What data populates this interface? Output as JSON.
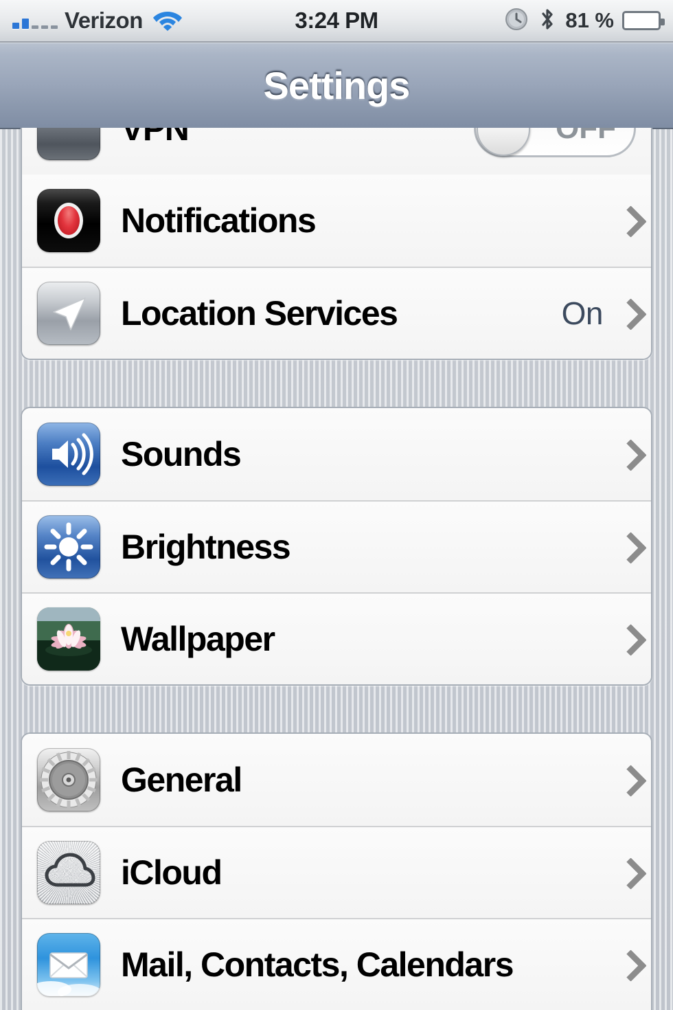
{
  "status_bar": {
    "carrier": "Verizon",
    "signal_bars_filled": 2,
    "signal_bars_total": 5,
    "wifi_icon": "wifi-icon",
    "time": "3:24 PM",
    "alarm_icon": "alarm-clock-icon",
    "bluetooth_icon": "bluetooth-icon",
    "battery_percent": "81 %",
    "battery_level": 81,
    "battery_color": "#5bc52c"
  },
  "nav_bar": {
    "title": "Settings"
  },
  "colors": {
    "accent_value": "#3c4a5e",
    "chevron": "#8c8c8c",
    "nav_bar": "#8c99ae",
    "group_bg": "#f7f7f7",
    "page_bg": "#c9ced6"
  },
  "groups": [
    {
      "id": "group-connectivity",
      "clipped_top": true,
      "rows": [
        {
          "id": "row-vpn",
          "label": "VPN",
          "icon": "vpn-icon",
          "control": "toggle",
          "toggle_label": "OFF",
          "toggle_on": false,
          "clipped": true
        },
        {
          "id": "row-notifications",
          "label": "Notifications",
          "icon": "notifications-icon",
          "value": "",
          "control": "disclosure"
        },
        {
          "id": "row-location-services",
          "label": "Location Services",
          "icon": "location-arrow-icon",
          "value": "On",
          "control": "disclosure"
        }
      ]
    },
    {
      "id": "group-display",
      "clipped_top": false,
      "rows": [
        {
          "id": "row-sounds",
          "label": "Sounds",
          "icon": "speaker-icon",
          "value": "",
          "control": "disclosure"
        },
        {
          "id": "row-brightness",
          "label": "Brightness",
          "icon": "sun-icon",
          "value": "",
          "control": "disclosure"
        },
        {
          "id": "row-wallpaper",
          "label": "Wallpaper",
          "icon": "water-lily-photo-icon",
          "value": "",
          "control": "disclosure"
        }
      ]
    },
    {
      "id": "group-system",
      "clipped_top": false,
      "clipped_bottom": true,
      "rows": [
        {
          "id": "row-general",
          "label": "General",
          "icon": "gears-icon",
          "value": "",
          "control": "disclosure"
        },
        {
          "id": "row-icloud",
          "label": "iCloud",
          "icon": "cloud-icon",
          "value": "",
          "control": "disclosure"
        },
        {
          "id": "row-mail-contacts-calendars",
          "label": "Mail, Contacts, Calendars",
          "icon": "envelope-icon",
          "value": "",
          "control": "disclosure"
        }
      ]
    }
  ]
}
